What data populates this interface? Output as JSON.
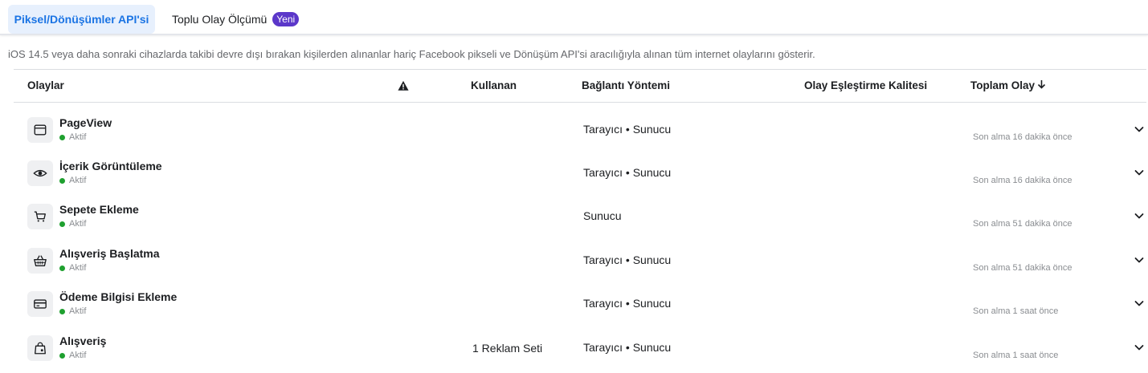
{
  "tabs": {
    "active_label": "Piksel/Dönüşümler API'si",
    "second_label": "Toplu Olay Ölçümü",
    "second_badge": "Yeni"
  },
  "description": "iOS 14.5 veya daha sonraki cihazlarda takibi devre dışı bırakan kişilerden alınanlar hariç Facebook pikseli ve Dönüşüm API'si aracılığıyla alınan tüm internet olaylarını gösterir.",
  "table": {
    "headers": {
      "events": "Olaylar",
      "used": "Kullanan",
      "connection": "Bağlantı Yöntemi",
      "match_quality": "Olay Eşleştirme Kalitesi",
      "total": "Toplam Olay"
    },
    "rows": [
      {
        "icon": "browser-window-icon",
        "name": "PageView",
        "status": "Aktif",
        "used": "",
        "connection": "Tarayıcı • Sunucu",
        "last": "Son alma 16 dakika önce"
      },
      {
        "icon": "eye-icon",
        "name": "İçerik Görüntüleme",
        "status": "Aktif",
        "used": "",
        "connection": "Tarayıcı • Sunucu",
        "last": "Son alma 16 dakika önce"
      },
      {
        "icon": "shopping-cart-icon",
        "name": "Sepete Ekleme",
        "status": "Aktif",
        "used": "",
        "connection": "Sunucu",
        "last": "Son alma 51 dakika önce"
      },
      {
        "icon": "shopping-basket-icon",
        "name": "Alışveriş Başlatma",
        "status": "Aktif",
        "used": "",
        "connection": "Tarayıcı • Sunucu",
        "last": "Son alma 51 dakika önce"
      },
      {
        "icon": "credit-card-icon",
        "name": "Ödeme Bilgisi Ekleme",
        "status": "Aktif",
        "used": "",
        "connection": "Tarayıcı • Sunucu",
        "last": "Son alma 1 saat önce"
      },
      {
        "icon": "shopping-bag-icon",
        "name": "Alışveriş",
        "status": "Aktif",
        "used": "1 Reklam Seti",
        "connection": "Tarayıcı • Sunucu",
        "last": "Son alma 1 saat önce"
      }
    ]
  },
  "colors": {
    "accent": "#1b74e4",
    "active_tab_bg": "#e7f0fd",
    "badge": "#5b37c9",
    "status_active": "#1fa02f"
  }
}
